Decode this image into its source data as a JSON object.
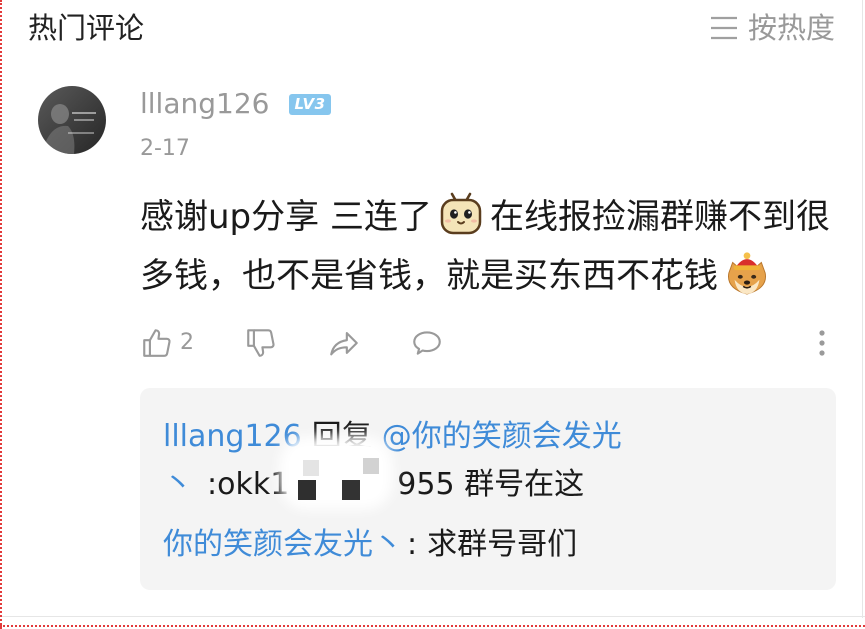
{
  "header": {
    "title": "热门评论",
    "sort_icon": "menu-lines-icon",
    "sort_label": "按热度"
  },
  "comment": {
    "avatar_icon": "user-avatar",
    "username": "lllang126",
    "level_badge": "LV3",
    "date": "2-17",
    "line1_a": "感谢up分享 三连了",
    "emoji1": "tv-face-emoji",
    "line1_b": "在线报捡漏群赚不到很",
    "line2_a": "多钱，也不是省钱，就是买东西不花钱",
    "emoji2": "doge-red-hat-emoji",
    "actions": {
      "like_icon": "thumbs-up-icon",
      "like_count": "2",
      "dislike_icon": "thumbs-down-icon",
      "share_icon": "share-icon",
      "reply_icon": "comment-bubble-icon",
      "more_icon": "more-vertical-icon"
    }
  },
  "replies": {
    "reply1": {
      "author": "lllang126",
      "reply_word": "回复",
      "mention_line1": "@你的笑颜会发光",
      "mention_line2": "丶",
      "content_a": ":okk1",
      "content_b": "955 群号在这"
    },
    "reply2": {
      "author": "你的笑颜会友光丶",
      "separator": ":",
      "content": "求群号哥们"
    }
  },
  "colors": {
    "text": "#1a1a1a",
    "muted": "#999999",
    "link": "#3f8bd8",
    "reply_bg": "#f4f4f4",
    "badge": "#86c6ee",
    "icon": "#9a9a9a"
  }
}
